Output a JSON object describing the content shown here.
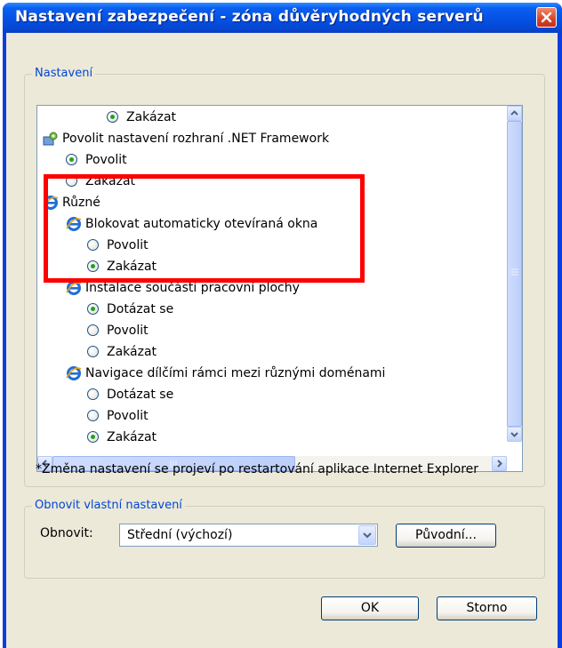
{
  "window": {
    "title": "Nastavení zabezpečení - zóna důvěryhodných serverů"
  },
  "settings_group": {
    "title": "Nastavení",
    "items": [
      {
        "type": "radio",
        "label": "Zakázat",
        "checked": true
      },
      {
        "type": "category",
        "label": "Povolit nastavení rozhraní .NET Framework",
        "icon": "settings-icon"
      },
      {
        "type": "radio",
        "label": "Povolit",
        "checked": true
      },
      {
        "type": "radio",
        "label": "Zakázat",
        "checked": false
      },
      {
        "type": "category",
        "label": "Různé",
        "icon": "ie-icon"
      },
      {
        "type": "category",
        "label": "Blokovat automaticky otevíraná okna",
        "icon": "ie-icon"
      },
      {
        "type": "radio",
        "label": "Povolit",
        "checked": false
      },
      {
        "type": "radio",
        "label": "Zakázat",
        "checked": true
      },
      {
        "type": "category",
        "label": "Instalace součástí pracovní plochy",
        "icon": "ie-icon"
      },
      {
        "type": "radio",
        "label": "Dotázat se",
        "checked": true
      },
      {
        "type": "radio",
        "label": "Povolit",
        "checked": false
      },
      {
        "type": "radio",
        "label": "Zakázat",
        "checked": false
      },
      {
        "type": "category",
        "label": "Navigace dílčími rámci mezi různými doménami",
        "icon": "ie-icon"
      },
      {
        "type": "radio",
        "label": "Dotázat se",
        "checked": false
      },
      {
        "type": "radio",
        "label": "Povolit",
        "checked": false
      },
      {
        "type": "radio",
        "label": "Zakázat",
        "checked": true
      }
    ],
    "restart_note": "*Změna nastavení se projeví po restartování aplikace Internet Explorer"
  },
  "reset_group": {
    "title": "Obnovit vlastní nastavení",
    "reset_label": "Obnovit:",
    "level_value": "Střední (výchozí)",
    "reset_button": "Původní..."
  },
  "buttons": {
    "ok": "OK",
    "cancel": "Storno"
  },
  "colors": {
    "titlebar": "#0553e6",
    "group_title": "#0046d5",
    "highlight": "#ff0000",
    "radio_dot": "#21a121"
  }
}
